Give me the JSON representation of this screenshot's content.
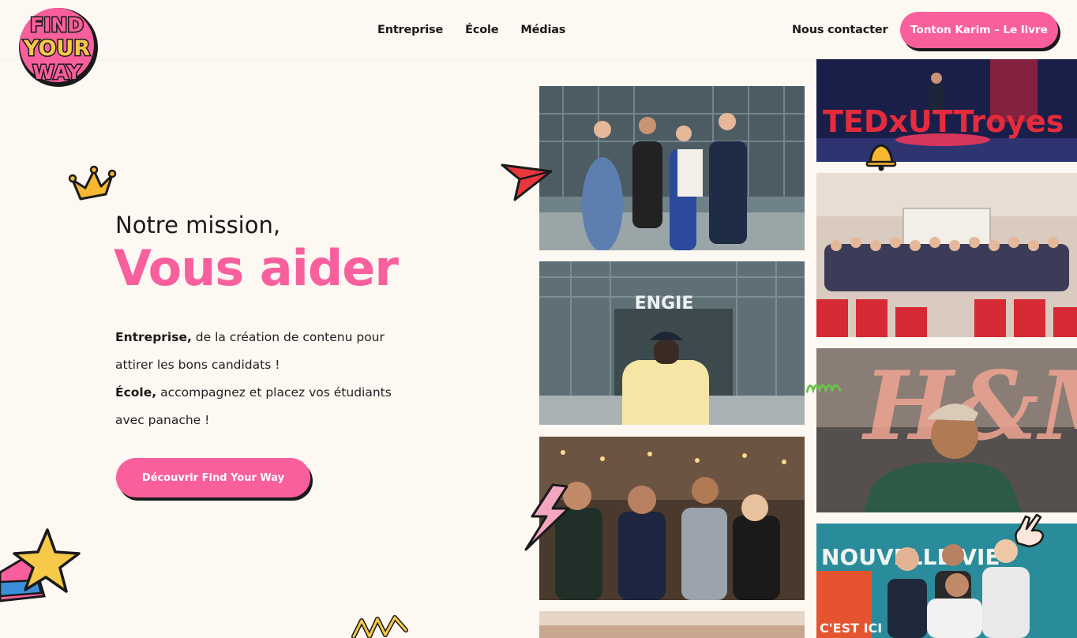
{
  "brand": {
    "logo_words": [
      "FIND",
      "YOUR",
      "WAY"
    ],
    "primary_color": "#f85f9c",
    "accent_yellow": "#f7c948",
    "text_color": "#1a1a1a",
    "background": "#fdf8f2"
  },
  "nav": {
    "items": [
      {
        "label": "Entreprise"
      },
      {
        "label": "École"
      },
      {
        "label": "Médias"
      }
    ],
    "contact_label": "Nous contacter",
    "cta_label": "Tonton Karim – Le livre"
  },
  "hero": {
    "intro": "Notre mission,",
    "title": "Vous aider",
    "paragraph_1_bold": "Entreprise,",
    "paragraph_1_rest": " de la création de contenu pour attirer les bons candidats !",
    "paragraph_2_bold": "École,",
    "paragraph_2_rest": " accompagnez et placez vos étudiants avec panache !",
    "cta_label": "Découvrir Find Your Way"
  },
  "photos": {
    "tedx_text": "TEDxUTTroyes",
    "engie_text": "ENGIE",
    "hm_text": "H&M",
    "nouvelle_text": "NOUVELLE VIE",
    "cest_text": "C'EST ICI"
  },
  "icons": [
    "crown-icon",
    "paper-plane-icon",
    "bell-icon",
    "lightning-icon",
    "star-icon",
    "zigzag-icon",
    "peace-hand-icon"
  ]
}
